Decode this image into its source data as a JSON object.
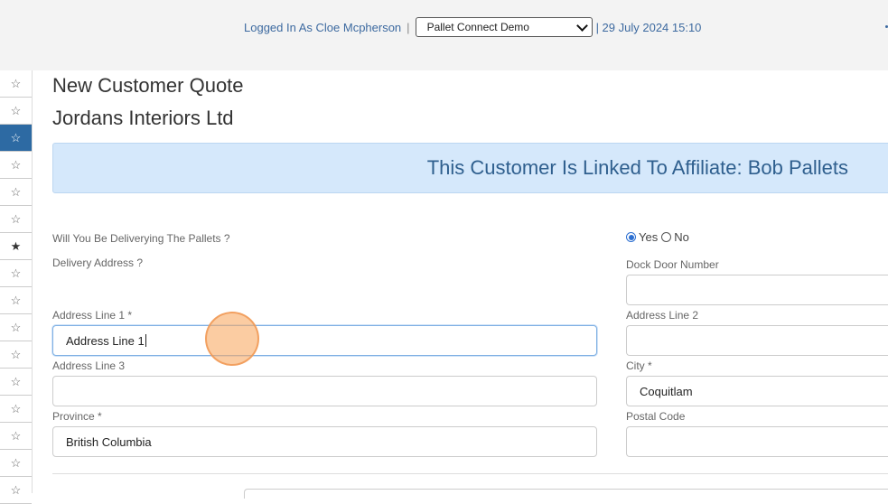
{
  "header": {
    "logged_in_label": "Logged In As Cloe Mcpherson",
    "separator": "|",
    "company_select": "Pallet Connect Demo",
    "datetime": "| 29 July 2024 15:10"
  },
  "sidebar": {
    "items": [
      {
        "icon": "star-outline-icon",
        "glyph": "☆",
        "state": "normal"
      },
      {
        "icon": "star-outline-icon",
        "glyph": "☆",
        "state": "normal"
      },
      {
        "icon": "star-outline-icon",
        "glyph": "☆",
        "state": "active"
      },
      {
        "icon": "star-outline-icon",
        "glyph": "☆",
        "state": "normal"
      },
      {
        "icon": "star-outline-icon",
        "glyph": "☆",
        "state": "normal"
      },
      {
        "icon": "star-outline-icon",
        "glyph": "☆",
        "state": "normal"
      },
      {
        "icon": "star-filled-icon",
        "glyph": "★",
        "state": "filled"
      },
      {
        "icon": "star-outline-icon",
        "glyph": "☆",
        "state": "normal"
      },
      {
        "icon": "star-outline-icon",
        "glyph": "☆",
        "state": "normal"
      },
      {
        "icon": "star-outline-icon",
        "glyph": "☆",
        "state": "normal"
      },
      {
        "icon": "star-outline-icon",
        "glyph": "☆",
        "state": "normal"
      },
      {
        "icon": "star-outline-icon",
        "glyph": "☆",
        "state": "normal"
      },
      {
        "icon": "star-outline-icon",
        "glyph": "☆",
        "state": "normal"
      },
      {
        "icon": "star-outline-icon",
        "glyph": "☆",
        "state": "normal"
      },
      {
        "icon": "star-outline-icon",
        "glyph": "☆",
        "state": "normal"
      },
      {
        "icon": "star-outline-icon",
        "glyph": "☆",
        "state": "normal"
      }
    ]
  },
  "page": {
    "title": "New Customer Quote",
    "customer_name": "Jordans Interiors Ltd",
    "affiliate_banner": "This Customer Is Linked To Affiliate: Bob Pallets"
  },
  "form": {
    "delivering_question": "Will You Be Deliverying The Pallets ?",
    "delivery_options": {
      "yes": "Yes",
      "no": "No",
      "selected": "Yes"
    },
    "delivery_address_label": "Delivery Address ?",
    "dock_door_label": "Dock Door Number",
    "dock_door_value": "",
    "address_line1_label": "Address Line 1 *",
    "address_line1_value": "Address Line 1",
    "address_line2_label": "Address Line 2",
    "address_line2_value": "",
    "address_line3_label": "Address Line 3",
    "address_line3_value": "",
    "city_label": "City *",
    "city_value": "Coquitlam",
    "province_label": "Province *",
    "province_value": "British Columbia",
    "postal_code_label": "Postal Code",
    "postal_code_value": ""
  },
  "colors": {
    "accent": "#2d6aa3",
    "banner_bg": "#d5e8fb",
    "banner_text": "#2f5f8e",
    "link": "#3d6aa0"
  }
}
